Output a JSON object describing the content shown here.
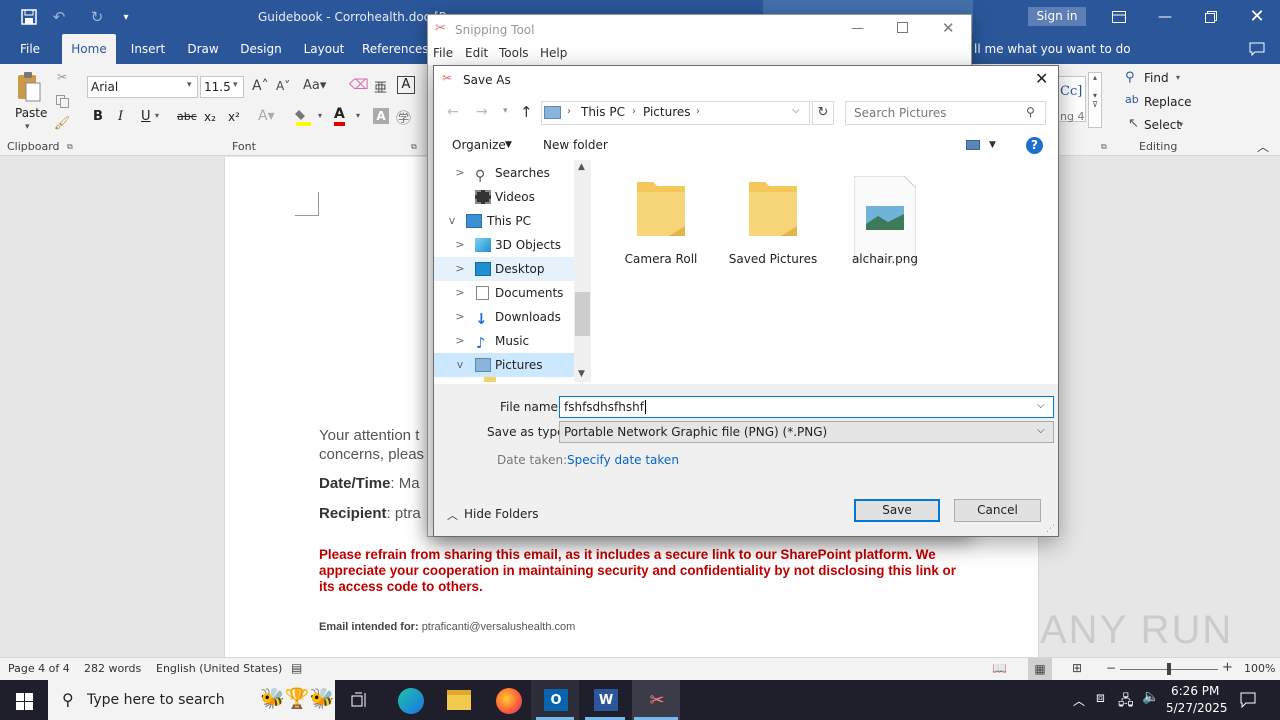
{
  "word": {
    "title": "Guidebook - Corrohealth.doc [R",
    "sign_in": "Sign in",
    "tabs": [
      "File",
      "Home",
      "Insert",
      "Draw",
      "Design",
      "Layout",
      "References"
    ],
    "tell_me": "ll me what you want to do",
    "font_name": "Arial",
    "font_size": "11.5",
    "paste": "Paste",
    "clipboard": "Clipboard",
    "font_group": "Font",
    "editing": "Editing",
    "find": "Find",
    "replace": "Replace",
    "select": "Select",
    "style_partial": "ng 4",
    "body": {
      "attention": "Your attention t",
      "concerns": "concerns, pleas",
      "datetime_label": "Date/Time",
      "datetime_value": ": Ma",
      "recipient_label": "Recipient",
      "recipient_value": ": ptra",
      "warning": "Please refrain from sharing this email, as it includes a secure link to our SharePoint platform. We appreciate your cooperation in maintaining security and confidentiality by not disclosing this link or its access code to others.",
      "email_label": "Email intended for:",
      "email_value": "ptraficanti@versalushealth.com"
    },
    "status": {
      "page": "Page 4 of 4",
      "words": "282 words",
      "language": "English (United States)",
      "zoom": "100%"
    }
  },
  "snipping_tool": {
    "title": "Snipping Tool",
    "menu": [
      "File",
      "Edit",
      "Tools",
      "Help"
    ]
  },
  "save_as": {
    "title": "Save As",
    "breadcrumb": [
      "This PC",
      "Pictures"
    ],
    "search_placeholder": "Search Pictures",
    "organize": "Organize",
    "new_folder": "New folder",
    "nav_items": [
      {
        "label": "Searches",
        "icon": "search-icon",
        "expand": ">"
      },
      {
        "label": "Videos",
        "icon": "videos-icon",
        "expand": ""
      },
      {
        "label": "This PC",
        "icon": "computer-icon",
        "expand": "v"
      },
      {
        "label": "3D Objects",
        "icon": "3d-objects-icon",
        "expand": ">"
      },
      {
        "label": "Desktop",
        "icon": "desktop-icon",
        "expand": ">"
      },
      {
        "label": "Documents",
        "icon": "documents-icon",
        "expand": ">"
      },
      {
        "label": "Downloads",
        "icon": "downloads-icon",
        "expand": ">"
      },
      {
        "label": "Music",
        "icon": "music-icon",
        "expand": ">"
      },
      {
        "label": "Pictures",
        "icon": "pictures-icon",
        "expand": "v"
      }
    ],
    "files": [
      {
        "label": "Camera Roll",
        "type": "folder"
      },
      {
        "label": "Saved Pictures",
        "type": "folder"
      },
      {
        "label": "alchair.png",
        "type": "image"
      }
    ],
    "file_name_label": "File name:",
    "file_name_value": "fshfsdhsfhshf",
    "save_type_label": "Save as type:",
    "save_type_value": "Portable Network Graphic file (PNG) (*.PNG)",
    "date_taken_label": "Date taken:",
    "date_taken_link": "Specify date taken",
    "hide_folders": "Hide Folders",
    "save": "Save",
    "cancel": "Cancel"
  },
  "taskbar": {
    "search_placeholder": "Type here to search",
    "time": "6:26 PM",
    "date": "5/27/2025"
  },
  "watermark": "ANY RUN",
  "colors": {
    "word_blue": "#2b579a",
    "accent": "#0078d7",
    "warning_red": "#c00000",
    "taskbar": "#1f1f2b"
  }
}
